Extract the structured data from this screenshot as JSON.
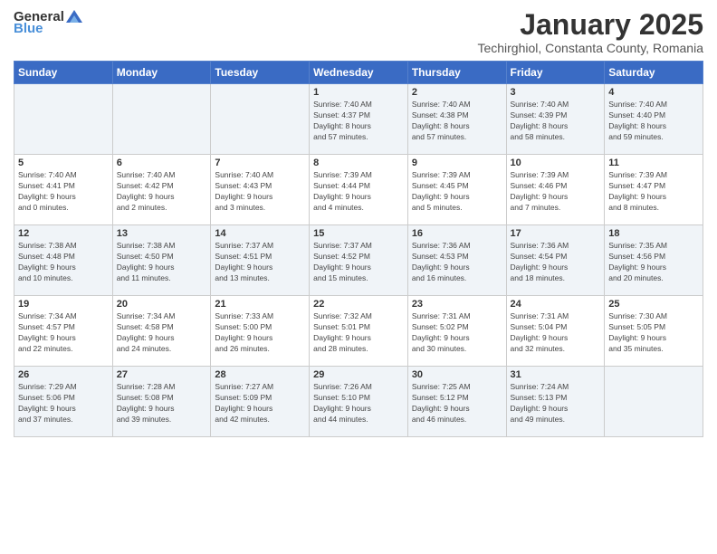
{
  "logo": {
    "general": "General",
    "blue": "Blue"
  },
  "title": "January 2025",
  "subtitle": "Techirghiol, Constanta County, Romania",
  "days_of_week": [
    "Sunday",
    "Monday",
    "Tuesday",
    "Wednesday",
    "Thursday",
    "Friday",
    "Saturday"
  ],
  "weeks": [
    [
      {
        "day": "",
        "info": ""
      },
      {
        "day": "",
        "info": ""
      },
      {
        "day": "",
        "info": ""
      },
      {
        "day": "1",
        "info": "Sunrise: 7:40 AM\nSunset: 4:37 PM\nDaylight: 8 hours\nand 57 minutes."
      },
      {
        "day": "2",
        "info": "Sunrise: 7:40 AM\nSunset: 4:38 PM\nDaylight: 8 hours\nand 57 minutes."
      },
      {
        "day": "3",
        "info": "Sunrise: 7:40 AM\nSunset: 4:39 PM\nDaylight: 8 hours\nand 58 minutes."
      },
      {
        "day": "4",
        "info": "Sunrise: 7:40 AM\nSunset: 4:40 PM\nDaylight: 8 hours\nand 59 minutes."
      }
    ],
    [
      {
        "day": "5",
        "info": "Sunrise: 7:40 AM\nSunset: 4:41 PM\nDaylight: 9 hours\nand 0 minutes."
      },
      {
        "day": "6",
        "info": "Sunrise: 7:40 AM\nSunset: 4:42 PM\nDaylight: 9 hours\nand 2 minutes."
      },
      {
        "day": "7",
        "info": "Sunrise: 7:40 AM\nSunset: 4:43 PM\nDaylight: 9 hours\nand 3 minutes."
      },
      {
        "day": "8",
        "info": "Sunrise: 7:39 AM\nSunset: 4:44 PM\nDaylight: 9 hours\nand 4 minutes."
      },
      {
        "day": "9",
        "info": "Sunrise: 7:39 AM\nSunset: 4:45 PM\nDaylight: 9 hours\nand 5 minutes."
      },
      {
        "day": "10",
        "info": "Sunrise: 7:39 AM\nSunset: 4:46 PM\nDaylight: 9 hours\nand 7 minutes."
      },
      {
        "day": "11",
        "info": "Sunrise: 7:39 AM\nSunset: 4:47 PM\nDaylight: 9 hours\nand 8 minutes."
      }
    ],
    [
      {
        "day": "12",
        "info": "Sunrise: 7:38 AM\nSunset: 4:48 PM\nDaylight: 9 hours\nand 10 minutes."
      },
      {
        "day": "13",
        "info": "Sunrise: 7:38 AM\nSunset: 4:50 PM\nDaylight: 9 hours\nand 11 minutes."
      },
      {
        "day": "14",
        "info": "Sunrise: 7:37 AM\nSunset: 4:51 PM\nDaylight: 9 hours\nand 13 minutes."
      },
      {
        "day": "15",
        "info": "Sunrise: 7:37 AM\nSunset: 4:52 PM\nDaylight: 9 hours\nand 15 minutes."
      },
      {
        "day": "16",
        "info": "Sunrise: 7:36 AM\nSunset: 4:53 PM\nDaylight: 9 hours\nand 16 minutes."
      },
      {
        "day": "17",
        "info": "Sunrise: 7:36 AM\nSunset: 4:54 PM\nDaylight: 9 hours\nand 18 minutes."
      },
      {
        "day": "18",
        "info": "Sunrise: 7:35 AM\nSunset: 4:56 PM\nDaylight: 9 hours\nand 20 minutes."
      }
    ],
    [
      {
        "day": "19",
        "info": "Sunrise: 7:34 AM\nSunset: 4:57 PM\nDaylight: 9 hours\nand 22 minutes."
      },
      {
        "day": "20",
        "info": "Sunrise: 7:34 AM\nSunset: 4:58 PM\nDaylight: 9 hours\nand 24 minutes."
      },
      {
        "day": "21",
        "info": "Sunrise: 7:33 AM\nSunset: 5:00 PM\nDaylight: 9 hours\nand 26 minutes."
      },
      {
        "day": "22",
        "info": "Sunrise: 7:32 AM\nSunset: 5:01 PM\nDaylight: 9 hours\nand 28 minutes."
      },
      {
        "day": "23",
        "info": "Sunrise: 7:31 AM\nSunset: 5:02 PM\nDaylight: 9 hours\nand 30 minutes."
      },
      {
        "day": "24",
        "info": "Sunrise: 7:31 AM\nSunset: 5:04 PM\nDaylight: 9 hours\nand 32 minutes."
      },
      {
        "day": "25",
        "info": "Sunrise: 7:30 AM\nSunset: 5:05 PM\nDaylight: 9 hours\nand 35 minutes."
      }
    ],
    [
      {
        "day": "26",
        "info": "Sunrise: 7:29 AM\nSunset: 5:06 PM\nDaylight: 9 hours\nand 37 minutes."
      },
      {
        "day": "27",
        "info": "Sunrise: 7:28 AM\nSunset: 5:08 PM\nDaylight: 9 hours\nand 39 minutes."
      },
      {
        "day": "28",
        "info": "Sunrise: 7:27 AM\nSunset: 5:09 PM\nDaylight: 9 hours\nand 42 minutes."
      },
      {
        "day": "29",
        "info": "Sunrise: 7:26 AM\nSunset: 5:10 PM\nDaylight: 9 hours\nand 44 minutes."
      },
      {
        "day": "30",
        "info": "Sunrise: 7:25 AM\nSunset: 5:12 PM\nDaylight: 9 hours\nand 46 minutes."
      },
      {
        "day": "31",
        "info": "Sunrise: 7:24 AM\nSunset: 5:13 PM\nDaylight: 9 hours\nand 49 minutes."
      },
      {
        "day": "",
        "info": ""
      }
    ]
  ]
}
